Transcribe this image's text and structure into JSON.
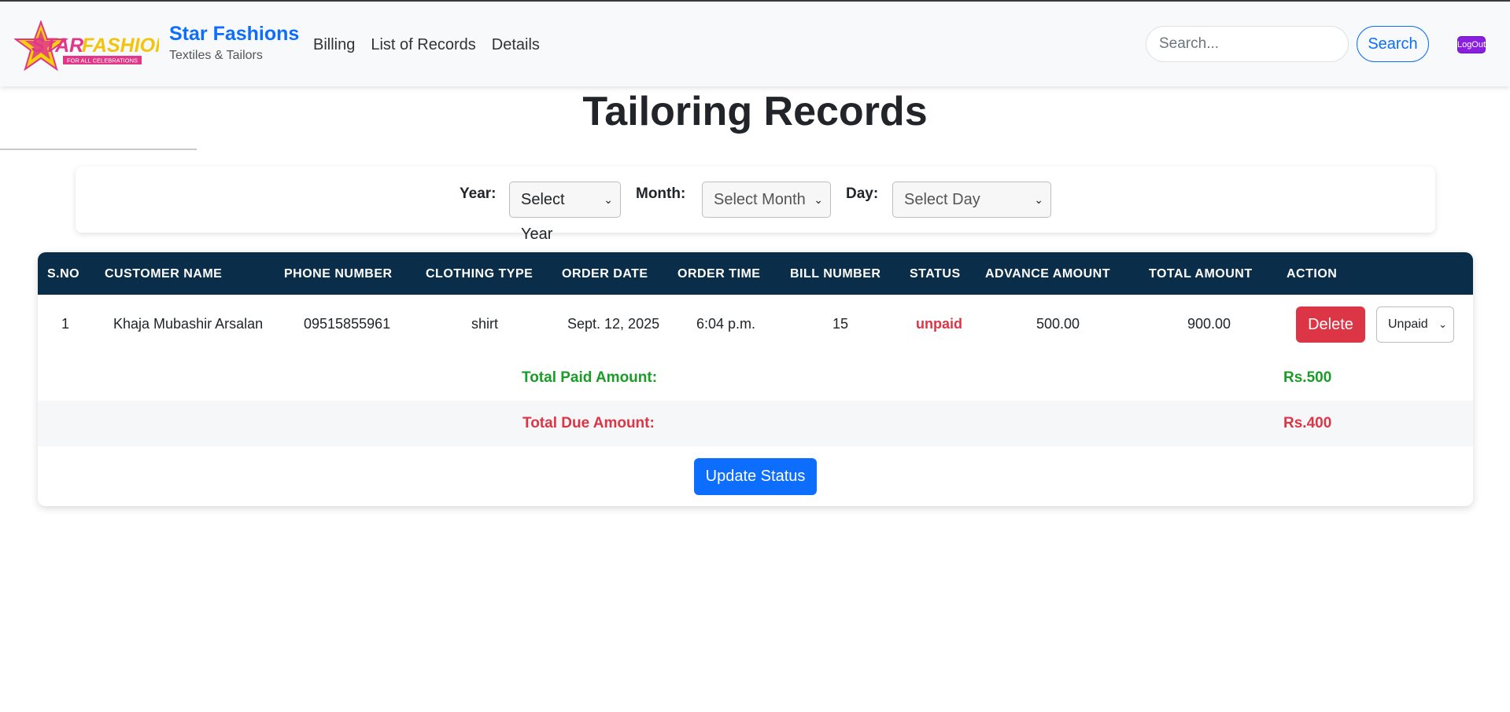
{
  "brand": {
    "logo_text": "STARFASHION",
    "logo_tagline": "FOR ALL CELEBRATIONS",
    "name": "Star Fashions",
    "subtitle": "Textiles & Tailors"
  },
  "nav": {
    "items": [
      "Billing",
      "List of Records",
      "Details"
    ]
  },
  "search": {
    "placeholder": "Search...",
    "button_label": "Search"
  },
  "logout_label": "LogOut",
  "page_title": "Tailoring Records",
  "filters": {
    "year_label": "Year:",
    "year_value": "Select Year",
    "month_label": "Month:",
    "month_value": "Select Month",
    "day_label": "Day:",
    "day_value": "Select Day"
  },
  "table": {
    "headers": [
      "S.NO",
      "CUSTOMER NAME",
      "PHONE NUMBER",
      "CLOTHING TYPE",
      "ORDER DATE",
      "ORDER TIME",
      "BILL NUMBER",
      "STATUS",
      "ADVANCE AMOUNT",
      "TOTAL AMOUNT",
      "ACTION"
    ],
    "rows": [
      {
        "sno": "1",
        "customer_name": "Khaja Mubashir Arsalan",
        "phone": "09515855961",
        "clothing_type": "shirt",
        "order_date": "Sept. 12, 2025",
        "order_time": "6:04 p.m.",
        "bill_number": "15",
        "status": "unpaid",
        "advance_amount": "500.00",
        "total_amount": "900.00",
        "delete_label": "Delete",
        "status_select": "Unpaid"
      }
    ]
  },
  "summary": {
    "paid_label": "Total Paid Amount:",
    "paid_value": "Rs.500",
    "due_label": "Total Due Amount:",
    "due_value": "Rs.400"
  },
  "update_button_label": "Update Status",
  "colors": {
    "primary": "#0d6efd",
    "table_header": "#0a2e4a",
    "danger": "#dc3545",
    "success": "#1a9c27"
  }
}
